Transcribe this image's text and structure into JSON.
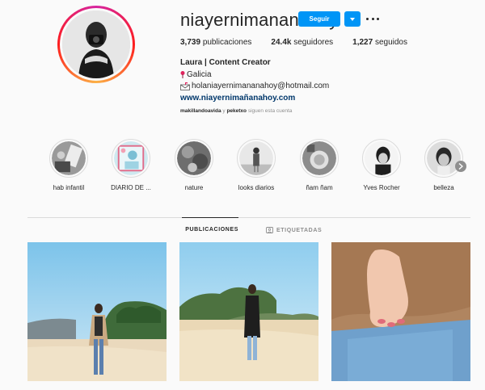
{
  "profile": {
    "username": "niayernimananahoy",
    "follow_label": "Seguir",
    "stats": {
      "posts_count": "3,739",
      "posts_label": "publicaciones",
      "followers_count": "24.4k",
      "followers_label": "seguidores",
      "following_count": "1,227",
      "following_label": "seguidos"
    },
    "bio": {
      "name": "Laura | Content Creator",
      "location": "Galicia",
      "email": "holaniayernimananahoy@hotmail.com",
      "website": "www.niayernimañanahoy.com"
    },
    "followed_by": {
      "user1": "makillandoavida",
      "connector": "y",
      "user2": "peketxo",
      "suffix": "siguen esta cuenta"
    }
  },
  "highlights": [
    {
      "label": "hab infantil",
      "icon": "highlight-hab-infantil"
    },
    {
      "label": "DIARIO DE ...",
      "icon": "highlight-diario"
    },
    {
      "label": "nature",
      "icon": "highlight-nature"
    },
    {
      "label": "looks diarios",
      "icon": "highlight-looks"
    },
    {
      "label": "ñam ñam",
      "icon": "highlight-nam-nam"
    },
    {
      "label": "Yves Rocher",
      "icon": "highlight-yves-rocher"
    },
    {
      "label": "belleza",
      "icon": "highlight-belleza"
    }
  ],
  "tabs": {
    "posts": "PUBLICACIONES",
    "tagged": "ETIQUETADAS"
  },
  "colors": {
    "accent": "#0095f6",
    "link": "#00376b",
    "muted": "#8e8e8e",
    "border": "#dbdbdb"
  }
}
